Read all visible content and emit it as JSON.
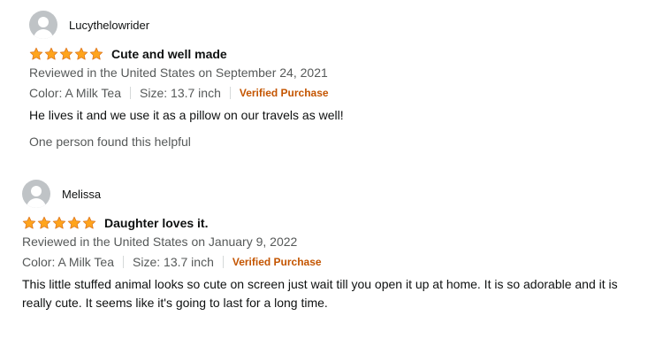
{
  "reviews": [
    {
      "author": "Lucythelowrider",
      "rating": 5,
      "title": "Cute and well made",
      "date": "Reviewed in the United States on September 24, 2021",
      "color": "Color: A Milk Tea",
      "size": "Size: 13.7 inch",
      "verified": "Verified Purchase",
      "body": "He lives it and we use it as a pillow on our travels as well!",
      "helpful": "One person found this helpful"
    },
    {
      "author": "Melissa",
      "rating": 5,
      "title": "Daughter loves it.",
      "date": "Reviewed in the United States on January 9, 2022",
      "color": "Color: A Milk Tea",
      "size": "Size: 13.7 inch",
      "verified": "Verified Purchase",
      "body": "This little stuffed animal looks so cute on screen just wait till you open it up at home. It is so adorable and it is really cute. It seems like it's going to last for a long time."
    }
  ],
  "colors": {
    "star": "#FFA41C",
    "star_stroke": "#DE7921",
    "verified": "#C45500",
    "secondary_text": "#565959",
    "primary_text": "#0F1111"
  },
  "icons": {
    "avatar": "default-profile-avatar-icon",
    "star": "star-icon"
  }
}
